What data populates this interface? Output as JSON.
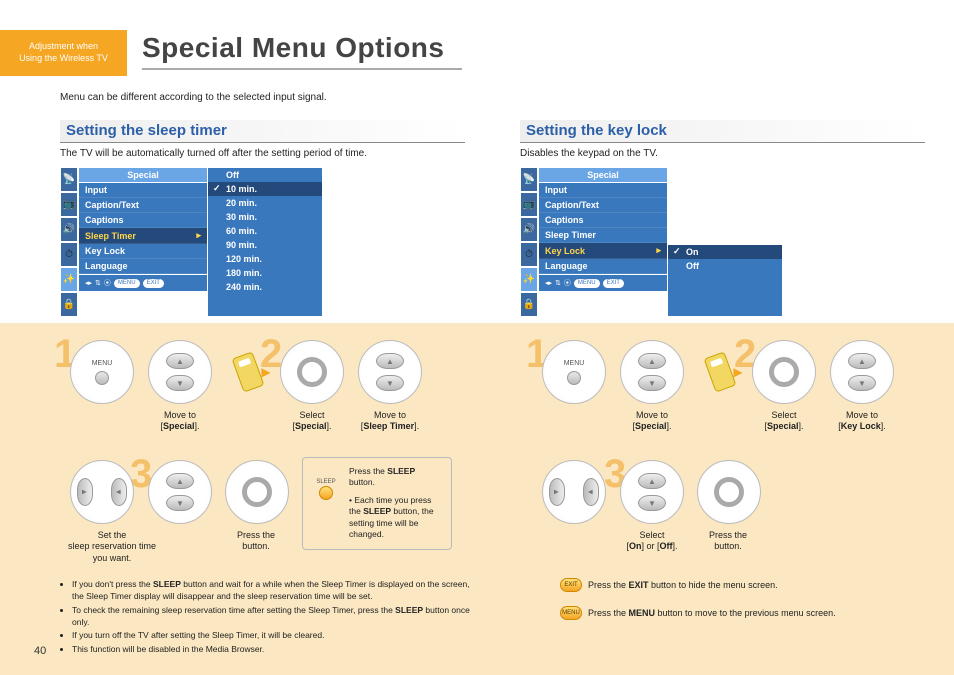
{
  "badge": {
    "line1": "Adjustment when",
    "line2": "Using the Wireless TV"
  },
  "title": "Special Menu Options",
  "intro": "Menu can be different according to the selected input signal.",
  "left": {
    "heading": "Setting the sleep timer",
    "desc": "The TV will be automatically turned off after the setting period of time."
  },
  "right": {
    "heading": "Setting the key lock",
    "desc": "Disables the keypad on the TV."
  },
  "osd": {
    "header": "Special",
    "items": [
      "Input",
      "Caption/Text",
      "Captions",
      "Sleep Timer",
      "Key Lock",
      "Language"
    ],
    "footer_menu": "MENU",
    "footer_exit": "EXIT",
    "sleep_options": [
      "Off",
      "10 min.",
      "20 min.",
      "30 min.",
      "60 min.",
      "90 min.",
      "120 min.",
      "180 min.",
      "240 min."
    ],
    "keylock_options": [
      "On",
      "Off"
    ]
  },
  "steps": {
    "n1": "1",
    "n2": "2",
    "n3": "3",
    "menu": "MENU",
    "move_special": "Move to\n[Special].",
    "select_special": "Select\n[Special].",
    "move_sleep": "Move to\n[Sleep Timer].",
    "move_keylock": "Move to\n[Key Lock].",
    "set_time": "Set the\nsleep reservation time\nyou want.",
    "press_btn": "Press the\nbutton.",
    "select_onoff": "Select\n[On] or [Off]."
  },
  "tips": {
    "sleep_label": "SLEEP",
    "sleep_line1": "Press the SLEEP button.",
    "sleep_line2": "Each time you press the SLEEP button, the setting time will be changed."
  },
  "bullets": [
    "If you don't press the SLEEP button and wait for a while when the Sleep Timer is displayed on the screen, the Sleep Timer display will disappear and the sleep reservation time will be set.",
    "To check the remaining sleep reservation time after setting the Sleep Timer, press the SLEEP button once only.",
    "If you turn off the TV after setting the Sleep Timer, it will be cleared.",
    "This function will be disabled in the Media Browser."
  ],
  "hints": {
    "exit_label": "EXIT",
    "exit_text": "Press the EXIT button to hide the menu screen.",
    "menu_label": "MENU",
    "menu_text": "Press the MENU button to move to the previous menu screen."
  },
  "page": "40"
}
